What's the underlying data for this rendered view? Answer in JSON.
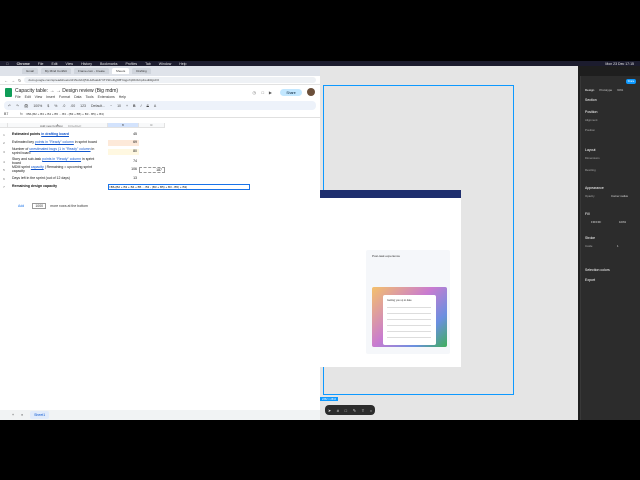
{
  "menubar": {
    "app": "Chrome",
    "items": [
      "File",
      "Edit",
      "View",
      "History",
      "Bookmarks",
      "Profiles",
      "Tab",
      "Window",
      "Help"
    ],
    "clock": "Mon 23 Dec 17:15"
  },
  "tabs": [
    {
      "label": "Gmail"
    },
    {
      "label": "My Mind Conflict"
    },
    {
      "label": "Frame.com - Create"
    },
    {
      "label": "Sheets"
    },
    {
      "label": "Drafting"
    }
  ],
  "address": {
    "url": "docs.google.com/spreadsheets/d/1NuGbQ51Hu8uaHbYtTzSFoDyjDBYiqgo7qDb3Lhp4/edit#gid=0"
  },
  "doc": {
    "title": "Capacity table: → → Design review (Big mdm)",
    "menus": [
      "File",
      "Edit",
      "View",
      "Insert",
      "Format",
      "Data",
      "Tools",
      "Extensions",
      "Help"
    ],
    "share_label": "Share"
  },
  "toolbar": {
    "items": [
      "↶",
      "↷",
      "🖨",
      "100%",
      "$",
      "%",
      ".0",
      ".00",
      "123",
      "Default...",
      "−",
      "10",
      "+",
      "B",
      "I",
      "S",
      "A"
    ]
  },
  "formula_bar": {
    "cell_ref": "B7",
    "fx": "fx",
    "formula": "=B6-(B2 + B3 + B4 + B5 ... B3 - (B3 + B5) + B3 - B5) + B3)"
  },
  "columns": [
    {
      "label": ""
    },
    {
      "label": "A"
    },
    {
      "label": "B"
    },
    {
      "label": "C"
    }
  ],
  "hint": {
    "text": "Add new function",
    "key": "Ctrl+Alt+F"
  },
  "rows": [
    {
      "num": "1",
      "label_pre": "Estimated points",
      "label_link": "in drafting board",
      "label_post": "",
      "value": "45",
      "bold": true
    },
    {
      "num": "2",
      "label_pre": "Estimated key ",
      "label_link": "points in \"Ready\" column",
      "label_post": " in sprint board",
      "value": "69",
      "bold": false
    },
    {
      "num": "3",
      "label_pre": "Number of ",
      "label_link": "unestimated bugs (1 in \"Ready\" column",
      "label_post": " in sprint board",
      "value": "80",
      "bold": false
    },
    {
      "num": "4",
      "label_pre": "Story and sub-task ",
      "label_link": "points in \"Ready\" column",
      "label_post": " in sprint board",
      "value": "74",
      "bold": false
    },
    {
      "num": "5",
      "label_pre": "MDM sprint ",
      "label_link": "capacity",
      "label_post": " | Remaining = upcoming sprint capacity",
      "value": "106",
      "value2": "187",
      "bold": false
    },
    {
      "num": "6",
      "label_pre": "Days left in the sprint (out of 12 days)",
      "label_link": "",
      "label_post": "",
      "value": "13",
      "bold": false
    },
    {
      "num": "7",
      "label_pre": "Remaining design capacity",
      "label_link": "",
      "label_post": "",
      "value": "=B6-(B2 + B3 + B4 + B5 ... B3 - (B3 + B5) + B3 - B5) + B3)",
      "bold": true
    }
  ],
  "add_rows": {
    "button": "Add",
    "count": "1000",
    "suffix": "more rows at the bottom"
  },
  "sheet_tabs": {
    "add": "+",
    "all": "≡",
    "active": "Sheet1"
  },
  "figma": {
    "panel_tabs": [
      "Design",
      "Prototype"
    ],
    "zoom": "64%",
    "play_label": "Share",
    "section_title": "Section",
    "sections": [
      {
        "title": "Position",
        "rows": [
          "Alignment",
          "Position"
        ]
      },
      {
        "title": "Layout",
        "rows": [
          "Dimensions",
          "Resizing"
        ]
      },
      {
        "title": "Appearance",
        "rows": [
          "Opacity",
          "Corner radius"
        ]
      },
      {
        "title": "Fill",
        "rows": [
          "FFFFFF",
          "100%"
        ]
      },
      {
        "title": "Stroke",
        "rows": [
          "Inside",
          "1"
        ]
      },
      {
        "title": "Selection colors",
        "rows": []
      },
      {
        "title": "Export",
        "rows": []
      }
    ],
    "frame_text": [
      "Post-task experience",
      "Getting you up to date"
    ],
    "size_badge": "2352 × 2816"
  }
}
